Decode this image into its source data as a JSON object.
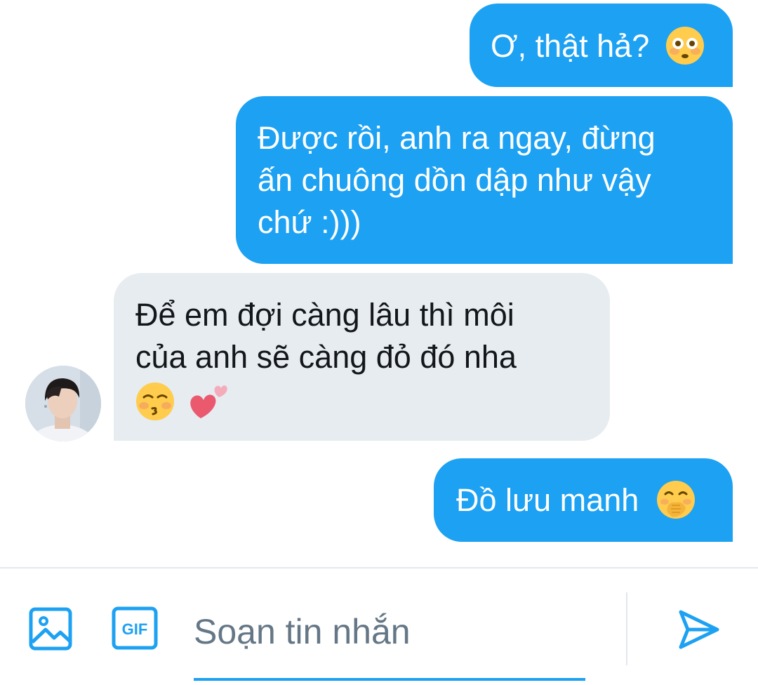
{
  "messages": [
    {
      "direction": "sent",
      "text": "Ơ, thật hả?",
      "emoji": "flushed-face-emoji"
    },
    {
      "direction": "sent",
      "text": "Được rồi, anh ra ngay, đừng\nấn chuông dồn dập như vậy\nchứ :)))"
    },
    {
      "direction": "received",
      "text": "Để em đợi càng lâu thì môi\ncủa anh sẽ càng đỏ đó nha",
      "emojis": [
        "kissing-closed-eyes-emoji",
        "two-hearts-emoji"
      ]
    },
    {
      "direction": "sent",
      "text": "Đồ lưu manh",
      "emoji": "face-with-hand-over-mouth-emoji"
    }
  ],
  "composer": {
    "placeholder": "Soạn tin nhắn",
    "media_icon": "image-icon",
    "gif_icon": "gif-icon",
    "gif_label": "GIF",
    "send_icon": "send-icon"
  },
  "colors": {
    "accent": "#1da1f2",
    "received_bubble": "#e6ecf0",
    "text_dark": "#14171a",
    "placeholder": "#657786"
  }
}
